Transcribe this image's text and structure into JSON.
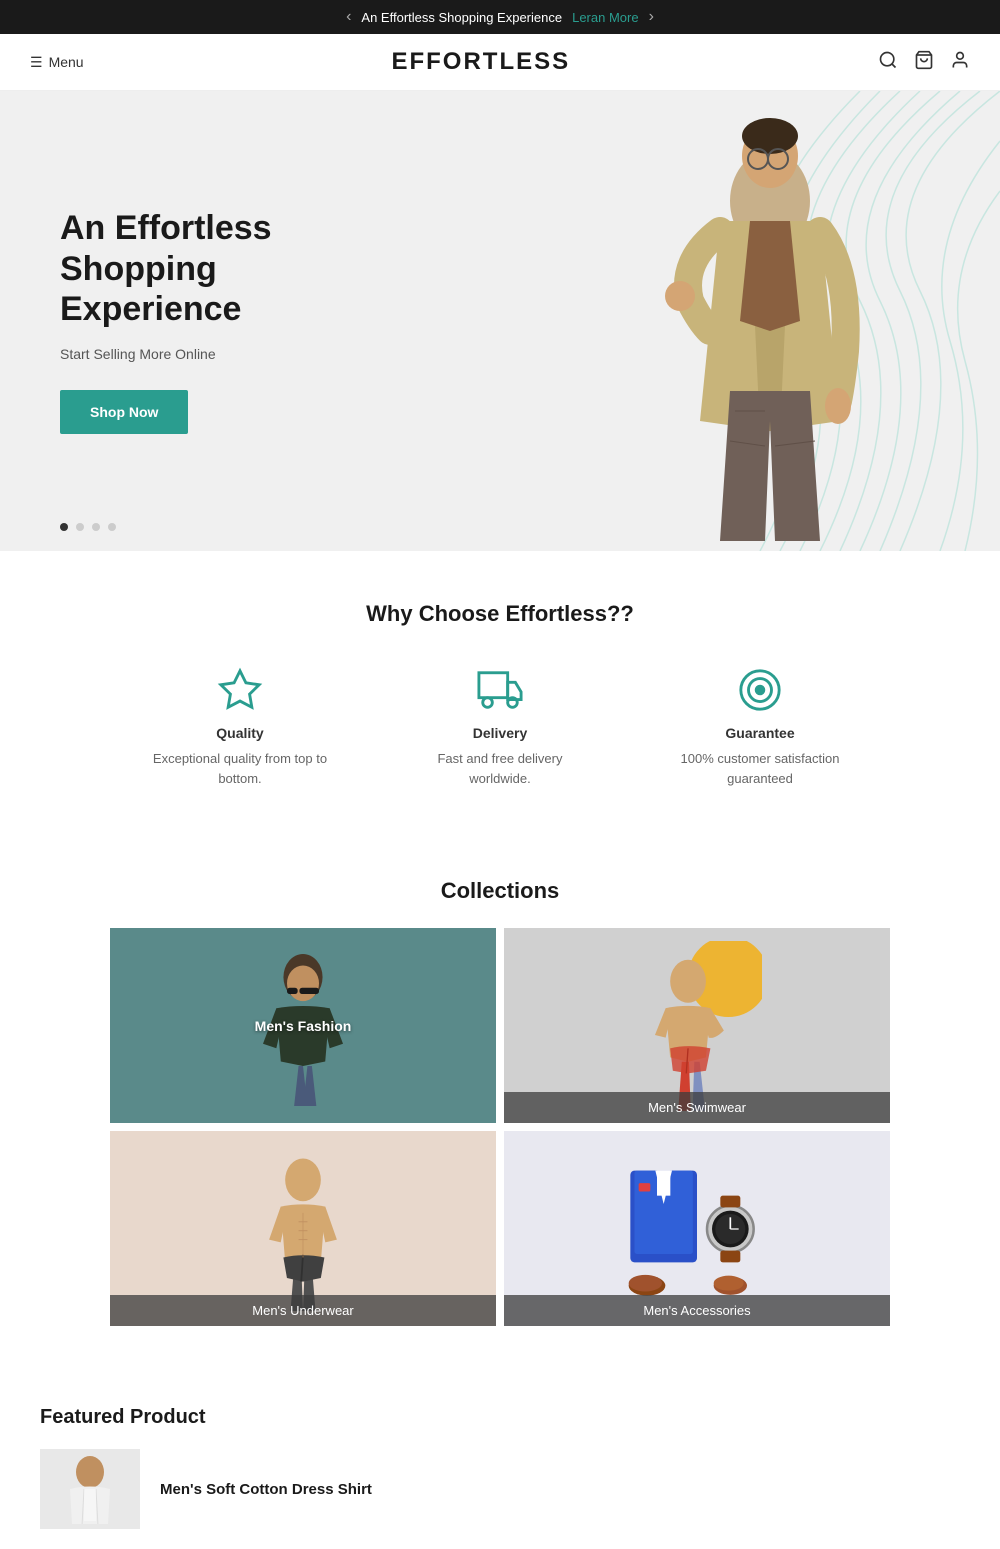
{
  "announcement": {
    "text": "An Effortless Shopping Experience",
    "link_text": "Leran More",
    "prev_arrow": "‹",
    "next_arrow": "›"
  },
  "header": {
    "menu_label": "Menu",
    "logo": "EFFORTLESS"
  },
  "hero": {
    "title_line1": "An Effortless",
    "title_line2": "Shopping Experience",
    "subtitle": "Start Selling More Online",
    "cta_label": "Shop Now"
  },
  "why": {
    "title": "Why Choose Effortless??",
    "features": [
      {
        "id": "quality",
        "name": "Quality",
        "desc": "Exceptional quality from top to bottom.",
        "icon": "star"
      },
      {
        "id": "delivery",
        "name": "Delivery",
        "desc": "Fast and free delivery worldwide.",
        "icon": "truck"
      },
      {
        "id": "guarantee",
        "name": "Guarantee",
        "desc": "100% customer satisfaction guaranteed",
        "icon": "badge"
      }
    ]
  },
  "collections": {
    "title": "Collections",
    "items": [
      {
        "id": "mens-fashion",
        "label": "Men's Fashion",
        "label_type": "center"
      },
      {
        "id": "mens-swimwear",
        "label": "Men's Swimwear",
        "label_type": "bottom"
      },
      {
        "id": "mens-underwear",
        "label": "Men's Underwear",
        "label_type": "bottom"
      },
      {
        "id": "mens-accessories",
        "label": "Men's Accessories",
        "label_type": "bottom"
      }
    ]
  },
  "featured": {
    "title": "Featured Product",
    "product_name": "Men's Soft Cotton Dress Shirt"
  },
  "colors": {
    "teal": "#2a9d8f",
    "dark": "#1a1a1a"
  }
}
